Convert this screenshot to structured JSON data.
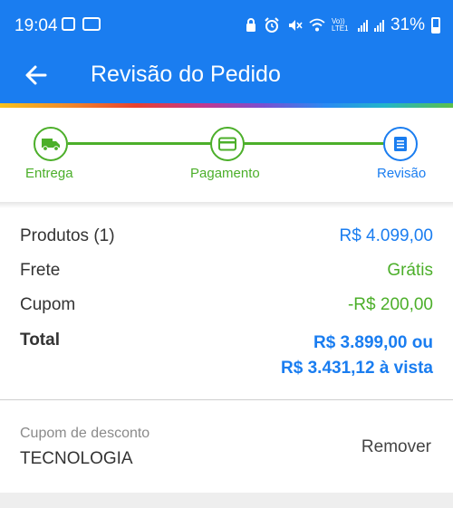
{
  "status_bar": {
    "time": "19:04",
    "network_label": "Vo)) LTE1",
    "battery": "31%",
    "icons": [
      "notification-box-icon",
      "notification-card-icon",
      "alarm-lock-icon",
      "alarm-icon",
      "mute-icon",
      "wifi-icon",
      "signal-icon",
      "battery-icon"
    ]
  },
  "app_bar": {
    "title": "Revisão do Pedido",
    "back_icon": "arrow-left-icon"
  },
  "colors": {
    "primary": "#1a7df0",
    "success": "#4caf2a"
  },
  "stepper": {
    "steps": [
      {
        "label": "Entrega",
        "icon": "truck-icon",
        "state": "done"
      },
      {
        "label": "Pagamento",
        "icon": "card-icon",
        "state": "done"
      },
      {
        "label": "Revisão",
        "icon": "list-icon",
        "state": "active"
      }
    ]
  },
  "summary": {
    "products": {
      "label": "Produtos (1)",
      "value": "R$ 4.099,00"
    },
    "shipping": {
      "label": "Frete",
      "value": "Grátis"
    },
    "coupon": {
      "label": "Cupom",
      "value": "-R$ 200,00"
    },
    "total": {
      "label": "Total",
      "value_line1": "R$ 3.899,00 ou",
      "value_line2": "R$ 3.431,12 à vista"
    }
  },
  "coupon_section": {
    "label": "Cupom de desconto",
    "code": "TECNOLOGIA",
    "remove_label": "Remover"
  }
}
